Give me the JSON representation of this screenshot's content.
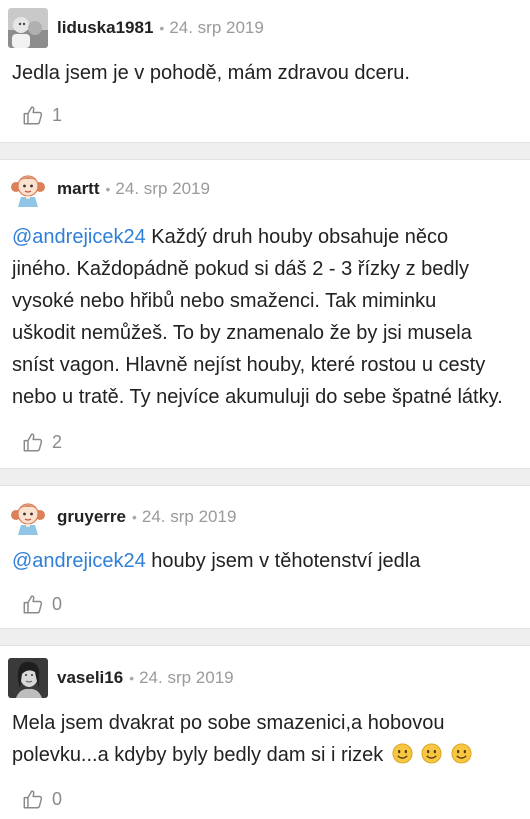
{
  "colors": {
    "mention": "#2f7fd8",
    "separator": "#efefef",
    "meta": "#9a9a9a",
    "text": "#222222"
  },
  "comments": [
    {
      "username": "liduska1981",
      "separator_dot": "•",
      "date": "24. srp 2019",
      "avatar": "photo-avatar",
      "mention": "",
      "text": "Jedla jsem je v pohodě, mám zdravou dceru.",
      "likes": "1"
    },
    {
      "username": "martt",
      "separator_dot": "•",
      "date": "24. srp 2019",
      "avatar": "cartoon-girl-avatar",
      "mention": "@andrejicek24",
      "text_line1": " Každý druh houby obsahuje něco",
      "text_lines": [
        "jiného. Každopádně pokud si dáš 2 - 3 řízky z bedly",
        "vysoké nebo hřibů nebo smaženci. Tak miminku",
        "uškodit nemůžeš. To by znamenalo že by jsi musela",
        "sníst vagon. Hlavně nejíst houby, které rostou u cesty",
        "nebo u tratě. Ty nejvíce akumuluji do sebe špatné látky."
      ],
      "likes": "2"
    },
    {
      "username": "gruyerre",
      "separator_dot": "•",
      "date": "24. srp 2019",
      "avatar": "cartoon-girl-avatar",
      "mention": "@andrejicek24",
      "text": " houby jsem v těhotenství jedla",
      "likes": "0"
    },
    {
      "username": "vaseli16",
      "separator_dot": "•",
      "date": "24. srp 2019",
      "avatar": "photo-avatar",
      "mention": "",
      "text_line1": "Mela jsem dvakrat po sobe smazenici,a hobovou",
      "text_line2": "polevku...a kdyby byly bedly dam si i rizek",
      "emoji": "smiley-face-icon",
      "likes": "0"
    }
  ]
}
